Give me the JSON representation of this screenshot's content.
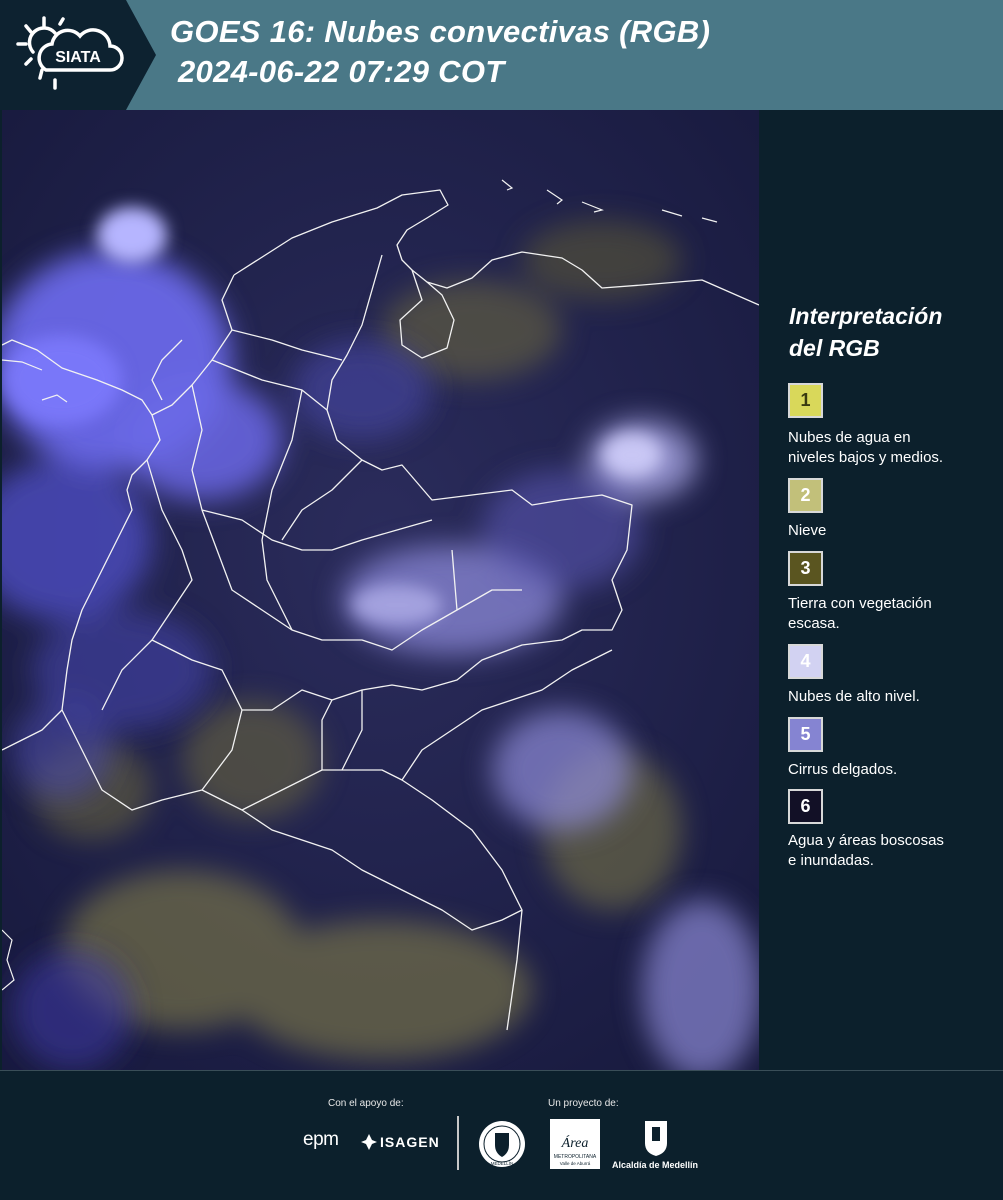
{
  "header": {
    "brand": "SIATA",
    "title_line1": "GOES 16: Nubes convectivas (RGB)",
    "title_line2": "2024-06-22 07:29 COT"
  },
  "map": {
    "icon": "satellite-rgb-image"
  },
  "legend": {
    "title_line1": "Interpretación",
    "title_line2": "del RGB",
    "items": [
      {
        "num": "1",
        "label_line1": "Nubes de agua en",
        "label_line2": "niveles bajos y medios.",
        "color": "#d9d85a",
        "text_color": "#3a3a10"
      },
      {
        "num": "2",
        "label_line1": "Nieve",
        "label_line2": "",
        "color": "#c2c07a",
        "text_color": "#ffffff"
      },
      {
        "num": "3",
        "label_line1": "Tierra con vegetación",
        "label_line2": "escasa.",
        "color": "#5a5520",
        "text_color": "#ffffff"
      },
      {
        "num": "4",
        "label_line1": "Nubes de alto nivel.",
        "label_line2": "",
        "color": "#d2d2f2",
        "text_color": "#ffffff"
      },
      {
        "num": "5",
        "label_line1": "Cirrus delgados.",
        "label_line2": "",
        "color": "#8584d2",
        "text_color": "#ffffff"
      },
      {
        "num": "6",
        "label_line1": "Agua y áreas boscosas",
        "label_line2": "e inundadas.",
        "color": "#121026",
        "text_color": "#ffffff"
      }
    ]
  },
  "footer": {
    "support_label": "Con el apoyo de:",
    "project_label": "Un proyecto de:",
    "sponsor1": "epm",
    "sponsor2": "ISAGEN",
    "partner1": "MEDELLÍN",
    "partner2_line1": "METROPOLITANA",
    "partner2_line2": "Valle de Aburrá",
    "partner3": "Alcaldía de Medellín"
  }
}
